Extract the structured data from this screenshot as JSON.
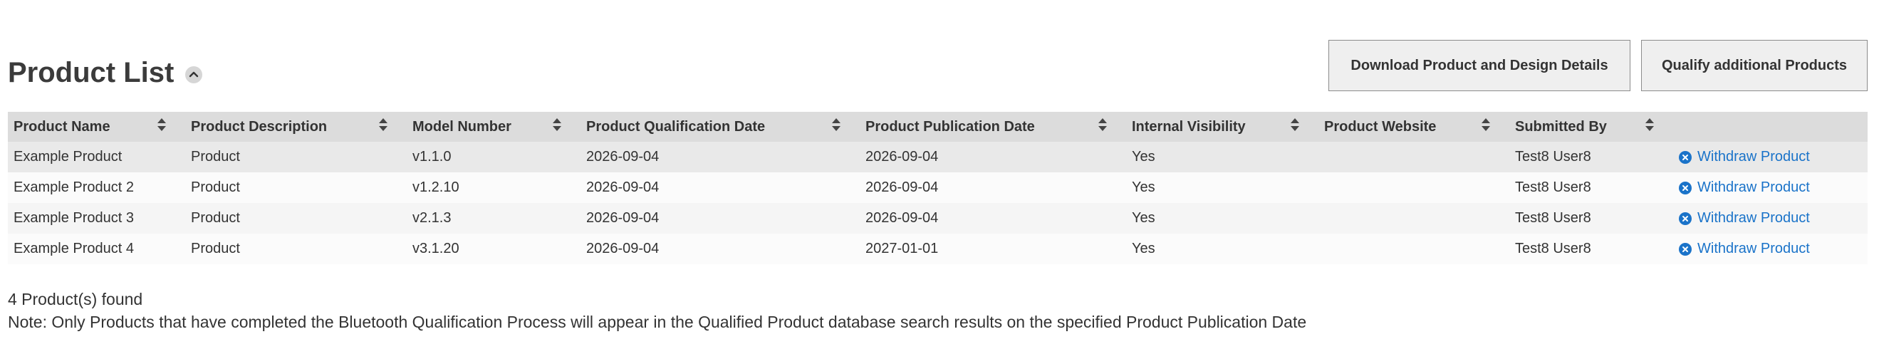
{
  "page": {
    "title": "Product List",
    "collapse_icon": "chevron-up-icon"
  },
  "actions": {
    "download_label": "Download Product and Design Details",
    "qualify_label": "Qualify additional Products"
  },
  "table": {
    "columns": [
      "Product Name",
      "Product Description",
      "Model Number",
      "Product Qualification Date",
      "Product Publication Date",
      "Internal Visibility",
      "Product Website",
      "Submitted By"
    ],
    "rows": [
      {
        "name": "Example Product",
        "description": "Product",
        "model": "v1.1.0",
        "qualification_date": "2026-09-04",
        "publication_date": "2026-09-04",
        "visibility": "Yes",
        "website": "",
        "submitted_by": "Test8 User8",
        "action": "Withdraw Product"
      },
      {
        "name": "Example Product 2",
        "description": "Product",
        "model": "v1.2.10",
        "qualification_date": "2026-09-04",
        "publication_date": "2026-09-04",
        "visibility": "Yes",
        "website": "",
        "submitted_by": "Test8 User8",
        "action": "Withdraw Product"
      },
      {
        "name": "Example Product 3",
        "description": "Product",
        "model": "v2.1.3",
        "qualification_date": "2026-09-04",
        "publication_date": "2026-09-04",
        "visibility": "Yes",
        "website": "",
        "submitted_by": "Test8 User8",
        "action": "Withdraw Product"
      },
      {
        "name": "Example Product 4",
        "description": "Product",
        "model": "v3.1.20",
        "qualification_date": "2026-09-04",
        "publication_date": "2027-01-01",
        "visibility": "Yes",
        "website": "",
        "submitted_by": "Test8 User8",
        "action": "Withdraw Product"
      }
    ]
  },
  "footer": {
    "count_text": "4 Product(s) found",
    "note_text": "Note: Only Products that have completed the Bluetooth Qualification Process will appear in the Qualified Product database search results on the specified Product Publication Date"
  },
  "colors": {
    "link": "#1a73c9",
    "header_bg": "#dcdcdc",
    "button_bg": "#efefef"
  }
}
